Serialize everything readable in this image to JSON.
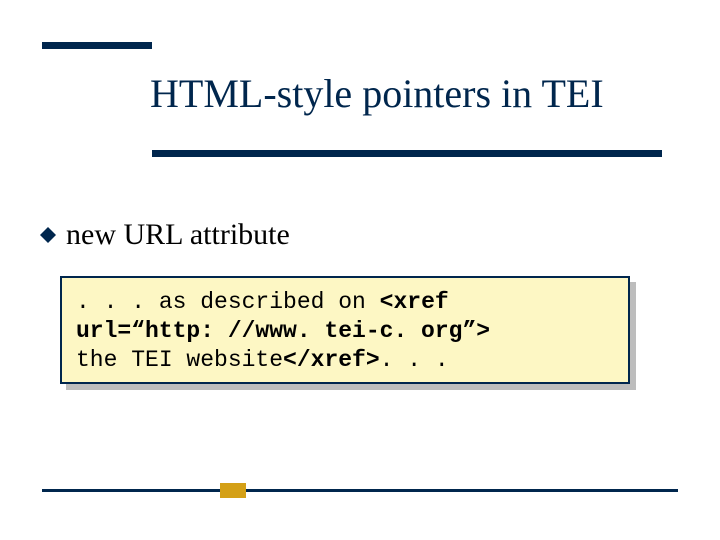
{
  "slide": {
    "title": "HTML-style pointers in TEI",
    "bullet": "new URL attribute",
    "code": {
      "pre1": ". . . as described on ",
      "tag_open_a": "<xref",
      "attr_line": "url=“http: //www. tei-c. org”>",
      "content": "the TEI website",
      "tag_close": "</xref>",
      "post": ". . ."
    }
  }
}
